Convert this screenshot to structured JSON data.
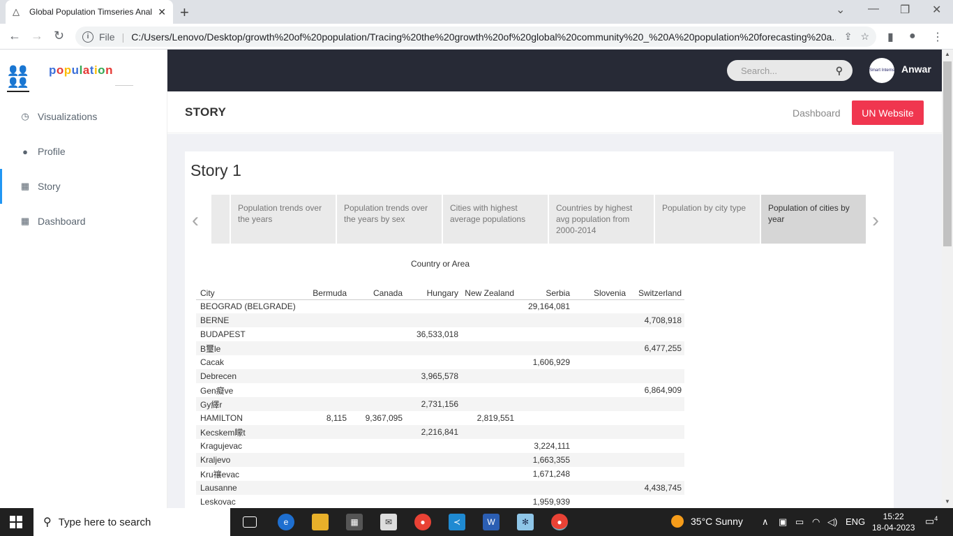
{
  "browser": {
    "tab_title": "Global Population Timseries Anal",
    "file_label": "File",
    "url": "C:/Users/Lenovo/Desktop/growth%20of%20population/Tracing%20the%20growth%20of%20global%20community%20_%20A%20population%20forecasting%20a..."
  },
  "sidebar": {
    "brand": "population",
    "items": [
      {
        "label": "Visualizations",
        "icon": "clock-icon"
      },
      {
        "label": "Profile",
        "icon": "person-icon"
      },
      {
        "label": "Story",
        "icon": "table-icon"
      },
      {
        "label": "Dashboard",
        "icon": "table-icon"
      }
    ]
  },
  "topbar": {
    "search_placeholder": "Search...",
    "avatar_text": "Smart Interns",
    "username": "Anwar"
  },
  "header": {
    "title": "STORY",
    "dashboard_link": "Dashboard",
    "un_button": "UN Website"
  },
  "story": {
    "title": "Story 1",
    "points": [
      "Population trends over the years",
      "Population trends over the years by sex",
      "Cities with highest average populations",
      "Countries  by highest avg population from 2000-2014",
      "Population by city type",
      "Population of cities by year"
    ]
  },
  "table": {
    "column_group": "Country or Area",
    "city_header": "City",
    "columns": [
      "Bermuda",
      "Canada",
      "Hungary",
      "New Zealand",
      "Serbia",
      "Slovenia",
      "Switzerland"
    ],
    "rows": [
      {
        "city": "BEOGRAD (BELGRADE)",
        "values": [
          "",
          "",
          "",
          "",
          "29,164,081",
          "",
          ""
        ]
      },
      {
        "city": "BERNE",
        "values": [
          "",
          "",
          "",
          "",
          "",
          "",
          "4,708,918"
        ]
      },
      {
        "city": "BUDAPEST",
        "values": [
          "",
          "",
          "36,533,018",
          "",
          "",
          "",
          ""
        ]
      },
      {
        "city": "B璽le",
        "values": [
          "",
          "",
          "",
          "",
          "",
          "",
          "6,477,255"
        ]
      },
      {
        "city": "Cacak",
        "values": [
          "",
          "",
          "",
          "",
          "1,606,929",
          "",
          ""
        ]
      },
      {
        "city": "Debrecen",
        "values": [
          "",
          "",
          "3,965,578",
          "",
          "",
          "",
          ""
        ]
      },
      {
        "city": "Gen癡ve",
        "values": [
          "",
          "",
          "",
          "",
          "",
          "",
          "6,864,909"
        ]
      },
      {
        "city": "Gy繹r",
        "values": [
          "",
          "",
          "2,731,156",
          "",
          "",
          "",
          ""
        ]
      },
      {
        "city": "HAMILTON",
        "values": [
          "8,115",
          "9,367,095",
          "",
          "2,819,551",
          "",
          "",
          ""
        ]
      },
      {
        "city": "Kecskem矇t",
        "values": [
          "",
          "",
          "2,216,841",
          "",
          "",
          "",
          ""
        ]
      },
      {
        "city": "Kragujevac",
        "values": [
          "",
          "",
          "",
          "",
          "3,224,111",
          "",
          ""
        ]
      },
      {
        "city": "Kraljevo",
        "values": [
          "",
          "",
          "",
          "",
          "1,663,355",
          "",
          ""
        ]
      },
      {
        "city": "Kru禳evac",
        "values": [
          "",
          "",
          "",
          "",
          "1,671,248",
          "",
          ""
        ]
      },
      {
        "city": "Lausanne",
        "values": [
          "",
          "",
          "",
          "",
          "",
          "",
          "4,438,745"
        ]
      },
      {
        "city": "Leskovac",
        "values": [
          "",
          "",
          "",
          "",
          "1,959,939",
          "",
          ""
        ]
      }
    ]
  },
  "taskbar": {
    "search_text": "Type here to search",
    "weather": "35°C  Sunny",
    "language": "ENG",
    "time": "15:22",
    "date": "18-04-2023",
    "notifications": "4"
  }
}
